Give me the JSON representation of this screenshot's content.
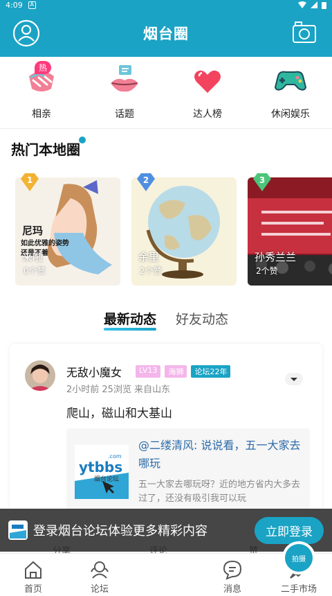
{
  "status": {
    "time": "4:09",
    "badge": "A"
  },
  "header": {
    "title": "烟台圈"
  },
  "quick": [
    {
      "label": "相亲",
      "icon": "handshake-icon",
      "tag": "热"
    },
    {
      "label": "话题",
      "icon": "lips-chat-icon"
    },
    {
      "label": "达人榜",
      "icon": "heart-icon"
    },
    {
      "label": "休闲娱乐",
      "icon": "gamepad-icon"
    }
  ],
  "hot": {
    "title": "热门本地圈",
    "cards": [
      {
        "rank": "1",
        "name": "来啦",
        "likes": "0个赞",
        "image_text": [
          "尼玛",
          "如此优雅的姿势",
          "还是不着"
        ]
      },
      {
        "rank": "2",
        "name": "余里",
        "likes": "2个赞"
      },
      {
        "rank": "3",
        "name": "孙秀兰兰",
        "likes": "2个赞"
      }
    ]
  },
  "tabs": [
    {
      "label": "最新动态",
      "active": true
    },
    {
      "label": "好友动态",
      "active": false
    }
  ],
  "post": {
    "user": "无敌小魔女",
    "tags": [
      "LV13",
      "海狮",
      "论坛22年"
    ],
    "meta": "2小时前  25浏览  来自山东",
    "text": "爬山，磁山和大基山",
    "share": {
      "title": "@二缕清风: 说说看，五一大家去哪玩",
      "desc": "五一大家去哪玩呀？近的地方省内大多去过了，还没有吸引我可以玩",
      "logo_text": "ytbbs",
      "logo_sub": "烟台论坛",
      "logo_com": ".com"
    },
    "actions": [
      "分享",
      "评论",
      "赞"
    ]
  },
  "banner": {
    "text": "登录烟台论坛体验更多精彩内容",
    "button": "立即登录"
  },
  "nav": [
    {
      "label": "首页",
      "icon": "home-icon"
    },
    {
      "label": "论坛",
      "icon": "forum-icon"
    },
    {
      "label": "",
      "icon": "camera-center-icon",
      "center": "拍摄"
    },
    {
      "label": "消息",
      "icon": "message-icon"
    },
    {
      "label": "二手市场",
      "icon": "rocket-icon"
    }
  ],
  "colors": {
    "primary": "#1aa3c5",
    "hot": "#ff3a7c",
    "link": "#2b6aa8"
  }
}
